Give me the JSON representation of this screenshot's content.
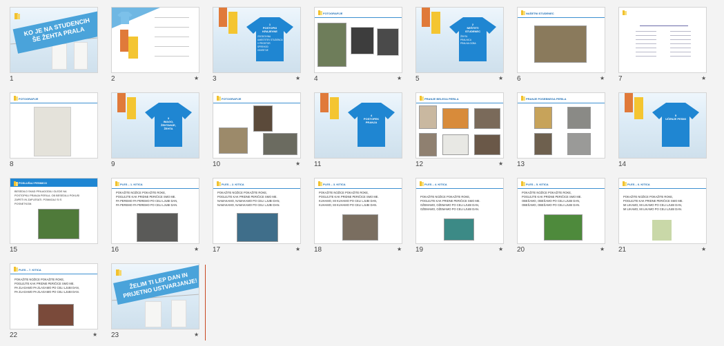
{
  "title_slide": {
    "line1": "KO JE NA STUDENCIH",
    "line2": "ŠE ŽEHTA PRALA"
  },
  "final_slide": {
    "line1": "ŽELIM TI LEP DAN IN",
    "line2": "PRIJETNO USTVARJANJE!"
  },
  "section_slides": {
    "s3": {
      "num": "1",
      "title": "POSTOPKI KRAJEVNE",
      "items": [
        "ZGODOVINA",
        "UMESTITEV STUDENCA",
        "V PROSTOR",
        "SPREHOD",
        "ODKRITJE"
      ]
    },
    "s5": {
      "num": "2",
      "title": "NEŠTETI STUDENEC",
      "items": [
        "ŽEHTA",
        "PRALNICA",
        "PRALNA GOBA"
      ]
    },
    "s9": {
      "num": "3",
      "title": "IMAGO, ŽEHTANJE, ŽEHTA"
    },
    "s11": {
      "num": "4",
      "title": "POSTOPEK PRANJA"
    },
    "s14": {
      "num": "5",
      "title": "UČENJE PESMI"
    }
  },
  "headers": {
    "fotografije": "FOTOGRAFIJE",
    "nasetni": "NAŠETNI STUDENEC",
    "pranje_belega": "PRANJE BELEGA PERILA",
    "pranje_pisanega": "PRANJE POSEBNEGA PERILA",
    "uvod": "POSLUŠAJ PESMICO",
    "ples1": "PLES – 1. KITICA",
    "ples2": "PLES – 2. KITICA",
    "ples3": "PLES – 3. KITICA",
    "ples4": "PLES – 4. KITICA",
    "ples5": "PLES – 5. KITICA",
    "ples6": "PLES – 6. KITICA",
    "ples7": "PLES – 7. KITICA"
  },
  "slide15_text": [
    "BESEDILO SKAD PRILAGODILI GLEDE NA",
    "POSTOPKU PRANJA PERILA. OB BESEDILU POKUSI",
    "ZAPETI IN ZAPLESATI. POMAGAJ SI S",
    "POSNETKOM."
  ],
  "verses": {
    "v16": [
      "POKAŽITE NOŽICE POKAŽITE ROKE,",
      "POGLEJTE KAK PRIDNE PERIČICE SMO ME.",
      "PA PEREMO PA PEREMO PO CELI LJUBI DAN,",
      "PA PEREMO PA PEREMO PO CELI LJUBI DAN."
    ],
    "v17": [
      "POKAŽITE NOŽICE POKAŽITE ROKE,",
      "POGLEJTE KAK PRIDNE PERIČICE SMO ME.",
      "NAMAKAMO, NAMAKAMO PO CELI LJUBI DAN,",
      "NAMAKAMO, NAMAKAMO PO CELI LJUBI DAN."
    ],
    "v18": [
      "POKAŽITE NOŽICE POKAŽITE ROKE,",
      "POGLEJTE KAK PRIDNE PERIČICE SMO ME.",
      "KUHAMO, MI KUHAMO PO CELI LJUBI DAN,",
      "KUHAMO, MI KUHAMO PO CELI LJUBI DAN."
    ],
    "v19": [
      "POKAŽITE NOŽICE POKAŽITE ROKE,",
      "POGLEJTE KAK PRIDNE PERIČICE SMO ME.",
      "OŽEMAMO, OŽEMAMO PO CELI LJUBI DAN,",
      "OŽEMAMO, OŽEMAMO PO CELI LJUBI DAN."
    ],
    "v20": [
      "POKAŽITE NOŽICE POKAŽITE ROKE,",
      "POGLEJTE KAK PRIDNE PERIČICE SMO ME.",
      "OBEŠAMO, OBEŠAMO PO CELI LJUBI DAN,",
      "OBEŠAMO, OBEŠAMO PO CELI LJUBI DAN."
    ],
    "v21": [
      "POKAŽITE NOŽICE POKAŽITE ROKE,",
      "POGLEJTE KAK PRIDNE PERIČICE SMO ME.",
      "MI LIKAMO, MI LIKAMO PO CELI LJUBI DAN,",
      "MI LIKAMO, MI LIKAMO PO CELI LJUBI DAN."
    ],
    "v22": [
      "POKAŽITE NOŽICE POKAŽITE ROKE,",
      "POGLEJTE KAK PRIDNE PERIČICE SMO ME.",
      "PA ZLAGAMO PA ZLAGAMO PO CELI LJUBI DAN,",
      "PA ZLAGAMO PA ZLAGAMO PO CELI LJUBI DAN."
    ]
  },
  "slide_numbers": [
    "1",
    "2",
    "3",
    "4",
    "5",
    "6",
    "7",
    "8",
    "9",
    "10",
    "11",
    "12",
    "13",
    "14",
    "15",
    "16",
    "17",
    "18",
    "19",
    "20",
    "21",
    "22",
    "23"
  ],
  "star_icon": "★",
  "colors": {
    "accent_blue": "#1f86d2",
    "selection": "#c7461f",
    "orange": "#e07a3a",
    "yellow": "#f4c531"
  }
}
